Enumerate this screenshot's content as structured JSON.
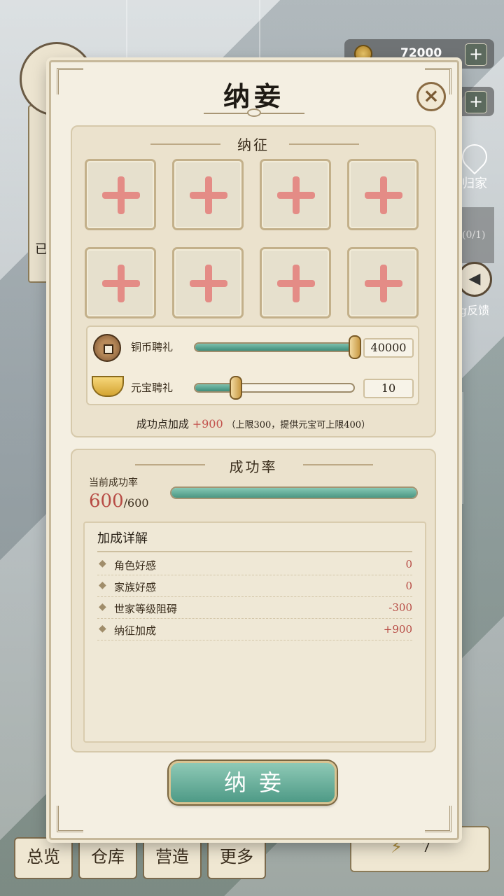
{
  "hud": {
    "copper_value": "72000",
    "plus_label": "+",
    "return_home_label": "归家",
    "quota_label": "(0/1)",
    "feedback_label": "g反馈",
    "left_partial_label": "已",
    "energy_value": "7"
  },
  "bottom_tabs": [
    "总览",
    "仓库",
    "营造",
    "更多"
  ],
  "modal": {
    "title": "纳妾",
    "close_label": "×",
    "recruit": {
      "heading": "纳征",
      "slot_count": 8,
      "copper_gift": {
        "label": "铜币聘礼",
        "value": "40000",
        "level": 1.0
      },
      "ingot_gift": {
        "label": "元宝聘礼",
        "value": "10",
        "level": 0.26
      },
      "bonus_label": "成功点加成",
      "bonus_value": "+900",
      "bonus_note": "（上限300，提供元宝可上限400）"
    },
    "success": {
      "heading": "成功率",
      "current_label": "当前成功率",
      "current_value": "600",
      "max_value": "/600",
      "progress": 1.0,
      "details_title": "加成详解",
      "details": [
        {
          "label": "角色好感",
          "value": "0"
        },
        {
          "label": "家族好感",
          "value": "0"
        },
        {
          "label": "世家等级阻碍",
          "value": "-300"
        },
        {
          "label": "纳征加成",
          "value": "+900"
        }
      ]
    },
    "submit_label": "纳妾"
  }
}
